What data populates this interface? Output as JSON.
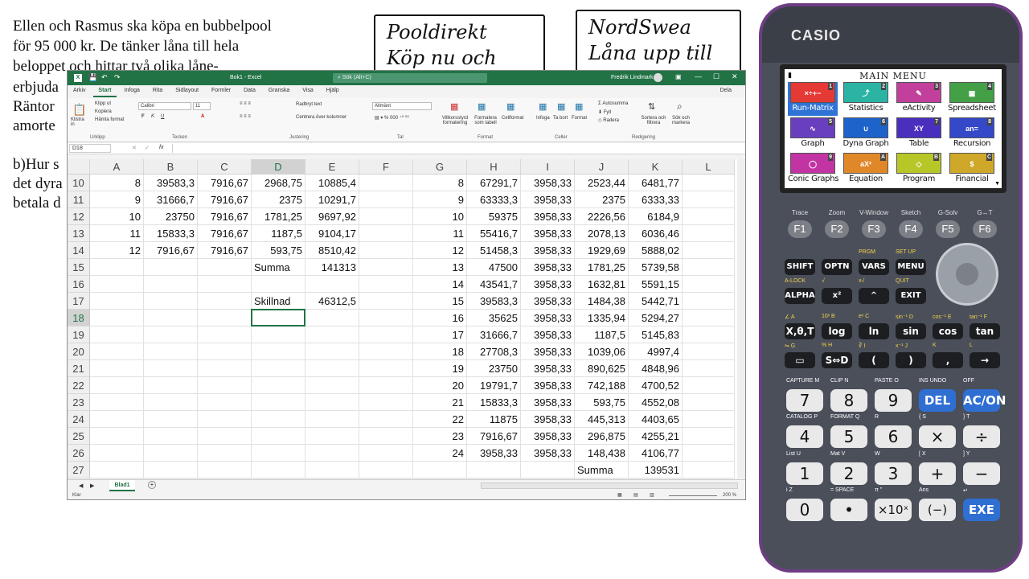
{
  "worksheet_text": {
    "lines": [
      "Ellen och Rasmus ska köpa en bubbelpool",
      "för 95 000 kr. De tänker låna till hela",
      "beloppet och hittar två olika låne-",
      "erbjuda",
      "Räntor",
      "amorte",
      "b)Hur s",
      "det dyra",
      "betala d"
    ],
    "box1": [
      "Pooldirekt",
      "Köp nu och dela"
    ],
    "box2": [
      "NordSwea",
      "Låna upp till"
    ]
  },
  "excel": {
    "title": "Bok1 - Excel",
    "search_placeholder": "Sök (Alt+C)",
    "user": "Fredrik Lindmark",
    "tabs": [
      "Arkiv",
      "Start",
      "Infoga",
      "Rita",
      "Sidlayout",
      "Formler",
      "Data",
      "Granska",
      "Visa",
      "Hjälp"
    ],
    "active_tab": "Start",
    "share_label": "Dela",
    "ribbon": {
      "clipboard": {
        "paste": "Klistra in",
        "cut": "Klipp ut",
        "copy": "Kopiera",
        "format_painter": "Hämta format",
        "group": "Urklipp"
      },
      "font": {
        "name": "Calibri",
        "size": "11",
        "group": "Tecken"
      },
      "alignment": {
        "wrap": "Radbryt text",
        "merge": "Centrera över kolumner",
        "group": "Justering"
      },
      "number": {
        "format": "Allmänt",
        "group": "Tal"
      },
      "styles": {
        "conditional": "Villkorsstyrd formatering",
        "table": "Formatera som tabell",
        "cell": "Cellformat",
        "group": "Format"
      },
      "cells": {
        "insert": "Infoga",
        "delete": "Ta bort",
        "format": "Format",
        "group": "Celler"
      },
      "editing": {
        "autosum": "Autosumma",
        "fill": "Fyll",
        "clear": "Radera",
        "sort": "Sortera och filtrera",
        "find": "Sök och markera",
        "group": "Redigering"
      }
    },
    "name_box": "D18",
    "fx": "fx",
    "columns": [
      "A",
      "B",
      "C",
      "D",
      "E",
      "F",
      "G",
      "H",
      "I",
      "J",
      "K",
      "L"
    ],
    "selected_column": "D",
    "selected_row": "18",
    "rows": [
      {
        "n": "10",
        "A": "8",
        "B": "39583,3",
        "C": "7916,67",
        "D": "2968,75",
        "E": "10885,4",
        "G": "8",
        "H": "67291,7",
        "I": "3958,33",
        "J": "2523,44",
        "K": "6481,77"
      },
      {
        "n": "11",
        "A": "9",
        "B": "31666,7",
        "C": "7916,67",
        "D": "2375",
        "E": "10291,7",
        "G": "9",
        "H": "63333,3",
        "I": "3958,33",
        "J": "2375",
        "K": "6333,33"
      },
      {
        "n": "12",
        "A": "10",
        "B": "23750",
        "C": "7916,67",
        "D": "1781,25",
        "E": "9697,92",
        "G": "10",
        "H": "59375",
        "I": "3958,33",
        "J": "2226,56",
        "K": "6184,9"
      },
      {
        "n": "13",
        "A": "11",
        "B": "15833,3",
        "C": "7916,67",
        "D": "1187,5",
        "E": "9104,17",
        "G": "11",
        "H": "55416,7",
        "I": "3958,33",
        "J": "2078,13",
        "K": "6036,46"
      },
      {
        "n": "14",
        "A": "12",
        "B": "7916,67",
        "C": "7916,67",
        "D": "593,75",
        "E": "8510,42",
        "G": "12",
        "H": "51458,3",
        "I": "3958,33",
        "J": "1929,69",
        "K": "5888,02"
      },
      {
        "n": "15",
        "D": "Summa",
        "E": "141313",
        "G": "13",
        "H": "47500",
        "I": "3958,33",
        "J": "1781,25",
        "K": "5739,58"
      },
      {
        "n": "16",
        "G": "14",
        "H": "43541,7",
        "I": "3958,33",
        "J": "1632,81",
        "K": "5591,15"
      },
      {
        "n": "17",
        "D": "Skillnad",
        "E": "46312,5",
        "G": "15",
        "H": "39583,3",
        "I": "3958,33",
        "J": "1484,38",
        "K": "5442,71"
      },
      {
        "n": "18",
        "G": "16",
        "H": "35625",
        "I": "3958,33",
        "J": "1335,94",
        "K": "5294,27"
      },
      {
        "n": "19",
        "G": "17",
        "H": "31666,7",
        "I": "3958,33",
        "J": "1187,5",
        "K": "5145,83"
      },
      {
        "n": "20",
        "G": "18",
        "H": "27708,3",
        "I": "3958,33",
        "J": "1039,06",
        "K": "4997,4"
      },
      {
        "n": "21",
        "G": "19",
        "H": "23750",
        "I": "3958,33",
        "J": "890,625",
        "K": "4848,96"
      },
      {
        "n": "22",
        "G": "20",
        "H": "19791,7",
        "I": "3958,33",
        "J": "742,188",
        "K": "4700,52"
      },
      {
        "n": "23",
        "G": "21",
        "H": "15833,3",
        "I": "3958,33",
        "J": "593,75",
        "K": "4552,08"
      },
      {
        "n": "24",
        "G": "22",
        "H": "11875",
        "I": "3958,33",
        "J": "445,313",
        "K": "4403,65"
      },
      {
        "n": "25",
        "G": "23",
        "H": "7916,67",
        "I": "3958,33",
        "J": "296,875",
        "K": "4255,21"
      },
      {
        "n": "26",
        "G": "24",
        "H": "3958,33",
        "I": "3958,33",
        "J": "148,438",
        "K": "4106,77"
      },
      {
        "n": "27",
        "J": "Summa",
        "K": "139531"
      }
    ],
    "sheet_tab": "Blad1",
    "status": "Klar",
    "zoom": "200 %"
  },
  "calculator": {
    "brand": "CASIO",
    "menu_title": "MAIN MENU",
    "apps": [
      {
        "label": "Run-Matrix",
        "num": "1",
        "color": "#e53935",
        "glyph": "×÷+−"
      },
      {
        "label": "Statistics",
        "num": "2",
        "color": "#2bb3a3",
        "glyph": "⤴"
      },
      {
        "label": "eActivity",
        "num": "3",
        "color": "#c2409b",
        "glyph": "✎"
      },
      {
        "label": "Spreadsheet",
        "num": "4",
        "color": "#43a047",
        "glyph": "▦"
      },
      {
        "label": "Graph",
        "num": "5",
        "color": "#6a3fbf",
        "glyph": "∿"
      },
      {
        "label": "Dyna Graph",
        "num": "6",
        "color": "#1e63c9",
        "glyph": "∪"
      },
      {
        "label": "Table",
        "num": "7",
        "color": "#4a2fbf",
        "glyph": "XY"
      },
      {
        "label": "Recursion",
        "num": "8",
        "color": "#3548c8",
        "glyph": "an="
      },
      {
        "label": "Conic Graphs",
        "num": "9",
        "color": "#c233a3",
        "glyph": "◯"
      },
      {
        "label": "Equation",
        "num": "A",
        "color": "#e0872a",
        "glyph": "aX²"
      },
      {
        "label": "Program",
        "num": "B",
        "color": "#b8c728",
        "glyph": "◇"
      },
      {
        "label": "Financial",
        "num": "C",
        "color": "#cfa82a",
        "glyph": "$"
      }
    ],
    "selected_app": "Run-Matrix",
    "fkeys": [
      {
        "top": "Trace",
        "label": "F1"
      },
      {
        "top": "Zoom",
        "label": "F2"
      },
      {
        "top": "V-Window",
        "label": "F3"
      },
      {
        "top": "Sketch",
        "label": "F4"
      },
      {
        "top": "G-Solv",
        "label": "F5"
      },
      {
        "top": "G↔T",
        "label": "F6"
      }
    ],
    "row1": [
      {
        "label": "SHIFT",
        "top": ""
      },
      {
        "label": "OPTN",
        "top": ""
      },
      {
        "label": "VARS",
        "top": "PRGM"
      },
      {
        "label": "MENU",
        "top": "SET UP"
      }
    ],
    "row2": [
      {
        "label": "ALPHA",
        "top": "A-LOCK"
      },
      {
        "label": "x²",
        "top": "√"
      },
      {
        "label": "^",
        "top": "x√"
      },
      {
        "label": "EXIT",
        "top": "QUIT"
      }
    ],
    "row3": [
      {
        "label": "X,θ,T",
        "top": "∠   A"
      },
      {
        "label": "log",
        "top": "10ˣ  B"
      },
      {
        "label": "ln",
        "top": "eˣ  C"
      },
      {
        "label": "sin",
        "top": "sin⁻¹ D"
      },
      {
        "label": "cos",
        "top": "cos⁻¹ E"
      },
      {
        "label": "tan",
        "top": "tan⁻¹ F"
      }
    ],
    "row4": [
      {
        "label": "▭",
        "top": "⇋   G"
      },
      {
        "label": "S⇔D",
        "top": "%  H"
      },
      {
        "label": "(",
        "top": "∛  I"
      },
      {
        "label": ")",
        "top": "x⁻¹ J"
      },
      {
        "label": ",",
        "top": "K"
      },
      {
        "label": "→",
        "top": "L"
      }
    ],
    "row5": [
      {
        "label": "7",
        "top": "CAPTURE M",
        "blue": false
      },
      {
        "label": "8",
        "top": "CLIP  N",
        "blue": false
      },
      {
        "label": "9",
        "top": "PASTE  O",
        "blue": false
      },
      {
        "label": "DEL",
        "top": "INS  UNDO",
        "blue": true
      },
      {
        "label": "AC/ON",
        "top": "OFF",
        "blue": true
      }
    ],
    "row6": [
      {
        "label": "4",
        "top": "CATALOG P"
      },
      {
        "label": "5",
        "top": "FORMAT Q"
      },
      {
        "label": "6",
        "top": "R"
      },
      {
        "label": "×",
        "top": "{  S"
      },
      {
        "label": "÷",
        "top": "}  T"
      }
    ],
    "row7": [
      {
        "label": "1",
        "top": "List  U"
      },
      {
        "label": "2",
        "top": "Mat  V"
      },
      {
        "label": "3",
        "top": "W"
      },
      {
        "label": "+",
        "top": "[  X"
      },
      {
        "label": "−",
        "top": "]  Y"
      }
    ],
    "row8": [
      {
        "label": "0",
        "top": "i   Z",
        "blue": false
      },
      {
        "label": "•",
        "top": "=  SPACE",
        "blue": false
      },
      {
        "label": "×10ˣ",
        "top": "π   \"",
        "blue": false
      },
      {
        "label": "(−)",
        "top": "Ans",
        "blue": false
      },
      {
        "label": "EXE",
        "top": "↵",
        "blue": true
      }
    ]
  }
}
